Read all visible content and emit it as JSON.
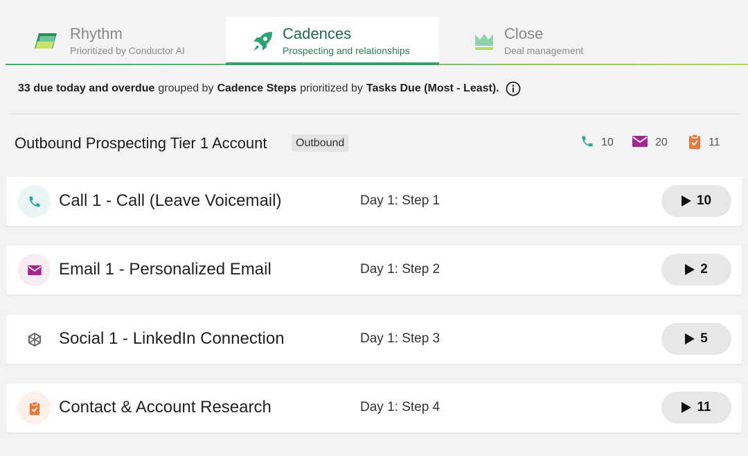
{
  "tabs": [
    {
      "title": "Rhythm",
      "subtitle": "Prioritized by Conductor AI",
      "active": false,
      "icon": "rhythm-icon"
    },
    {
      "title": "Cadences",
      "subtitle": "Prospecting and relationships",
      "active": true,
      "icon": "rocket-icon"
    },
    {
      "title": "Close",
      "subtitle": "Deal management",
      "active": false,
      "icon": "crown-icon"
    }
  ],
  "summary": {
    "count_text": "33 due today and overdue",
    "grouped_by_label": "grouped by",
    "grouped_by_value": "Cadence Steps",
    "prioritized_by_label": "prioritized by",
    "prioritized_by_value": "Tasks Due (Most - Least)."
  },
  "cadence": {
    "title": "Outbound Prospecting Tier 1 Account",
    "badge": "Outbound",
    "counts": {
      "calls": "10",
      "emails": "20",
      "tasks": "11"
    }
  },
  "steps": [
    {
      "name": "Call 1 - Call (Leave Voicemail)",
      "step": "Day 1: Step 1",
      "count": "10",
      "type": "phone"
    },
    {
      "name": "Email 1 - Personalized Email",
      "step": "Day 1: Step 2",
      "count": "2",
      "type": "email"
    },
    {
      "name": "Social 1 - LinkedIn Connection",
      "step": "Day 1: Step 3",
      "count": "5",
      "type": "social"
    },
    {
      "name": "Contact & Account Research",
      "step": "Day 1: Step 4",
      "count": "11",
      "type": "task"
    }
  ],
  "colors": {
    "phone": "#2fa6a0",
    "email": "#a4268f",
    "task": "#e7773a",
    "social": "#666666",
    "active_tab": "#1f6b4a"
  }
}
